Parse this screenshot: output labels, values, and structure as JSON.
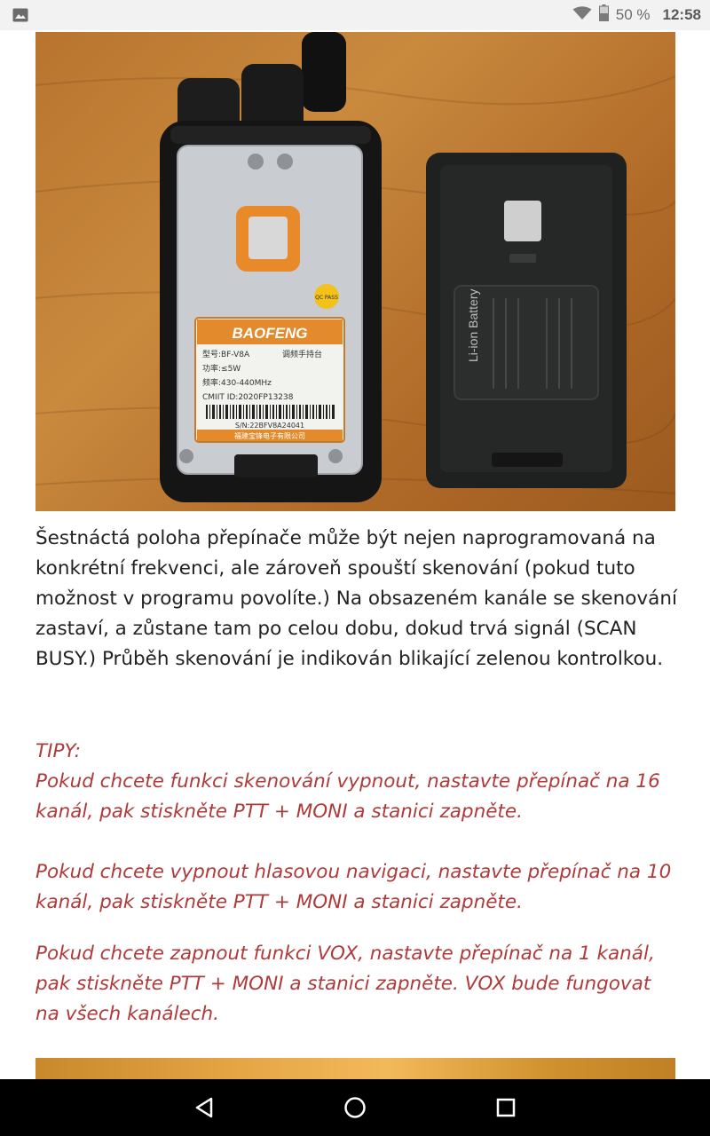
{
  "status_bar": {
    "battery_percent": "50 %",
    "time": "12:58",
    "icons": [
      "image-icon",
      "wifi-icon",
      "battery-icon"
    ]
  },
  "photo": {
    "label_brand": "BAOFENG",
    "label_model": "型号:BF-V8A",
    "label_type": "调频手持台",
    "label_power": "功率:≤5W",
    "label_freq": "频率:430-440MHz",
    "label_cmiit": "CMIIT ID:2020FP13238",
    "label_sn": "S/N:22BFV8A24041",
    "label_maker": "福建宝锋电子有限公司",
    "qc_sticker": "QC PASS",
    "battery_text": "Li-ion Battery"
  },
  "article": {
    "paragraph": "Šestnáctá poloha přepínače může být nejen naprogramovaná na konkrétní frekvenci, ale zároveň spouští skenování (pokud tuto možnost v programu povolíte.) Na obsazeném kanále se skenování zastaví, a zůstane tam po celou dobu, dokud trvá signál (SCAN BUSY.) Průběh skenování je indikován blikající zelenou kontrolkou.",
    "tips_heading": "TIPY:",
    "tip1": "Pokud chcete funkci skenování vypnout, nastavte přepínač na 16 kanál, pak stiskněte PTT + MONI a stanici zapněte.",
    "tip2": "Pokud chcete vypnout hlasovou navigaci, nastavte přepínač na 10 kanál, pak stiskněte PTT + MONI a stanici zapněte.",
    "tip3": "Pokud chcete zapnout funkci VOX, nastavte přepínač na 1 kanál, pak stiskněte PTT + MONI a stanici zapněte. VOX bude fungovat na všech kanálech."
  },
  "nav_bar": {
    "buttons": [
      "back-icon",
      "home-icon",
      "recents-icon"
    ]
  },
  "colors": {
    "tips_text": "#b03a3a",
    "body_text": "#222222",
    "status_bar_bg": "#f2f2f2",
    "nav_bar_bg": "#000000"
  }
}
